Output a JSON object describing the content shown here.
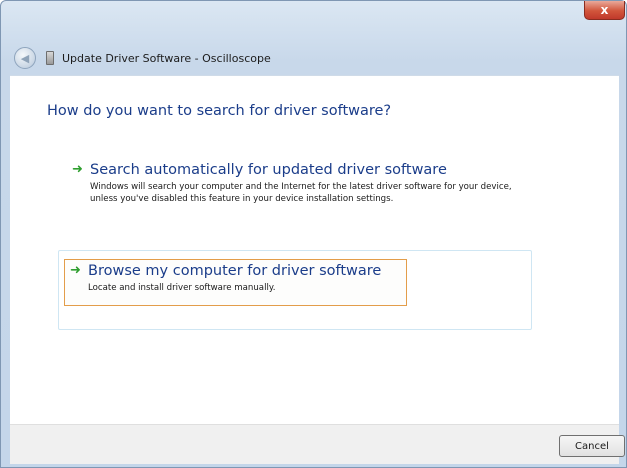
{
  "window": {
    "title": "Update Driver Software - Oscilloscope",
    "close_label": "x"
  },
  "main": {
    "question": "How do you want to search for driver software?",
    "options": [
      {
        "icon": "green-arrow-icon",
        "title": "Search automatically for updated driver software",
        "description": "Windows will search your computer and the Internet for the latest driver software for your device, unless you've disabled this feature in your device installation settings."
      },
      {
        "icon": "green-arrow-icon",
        "title": "Browse my computer for driver software",
        "description": "Locate and install driver software manually."
      }
    ]
  },
  "footer": {
    "cancel_label": "Cancel"
  },
  "colors": {
    "accent_text": "#1b3d8a",
    "arrow_green": "#2f9e2f",
    "highlight_border": "#e39d4a"
  }
}
